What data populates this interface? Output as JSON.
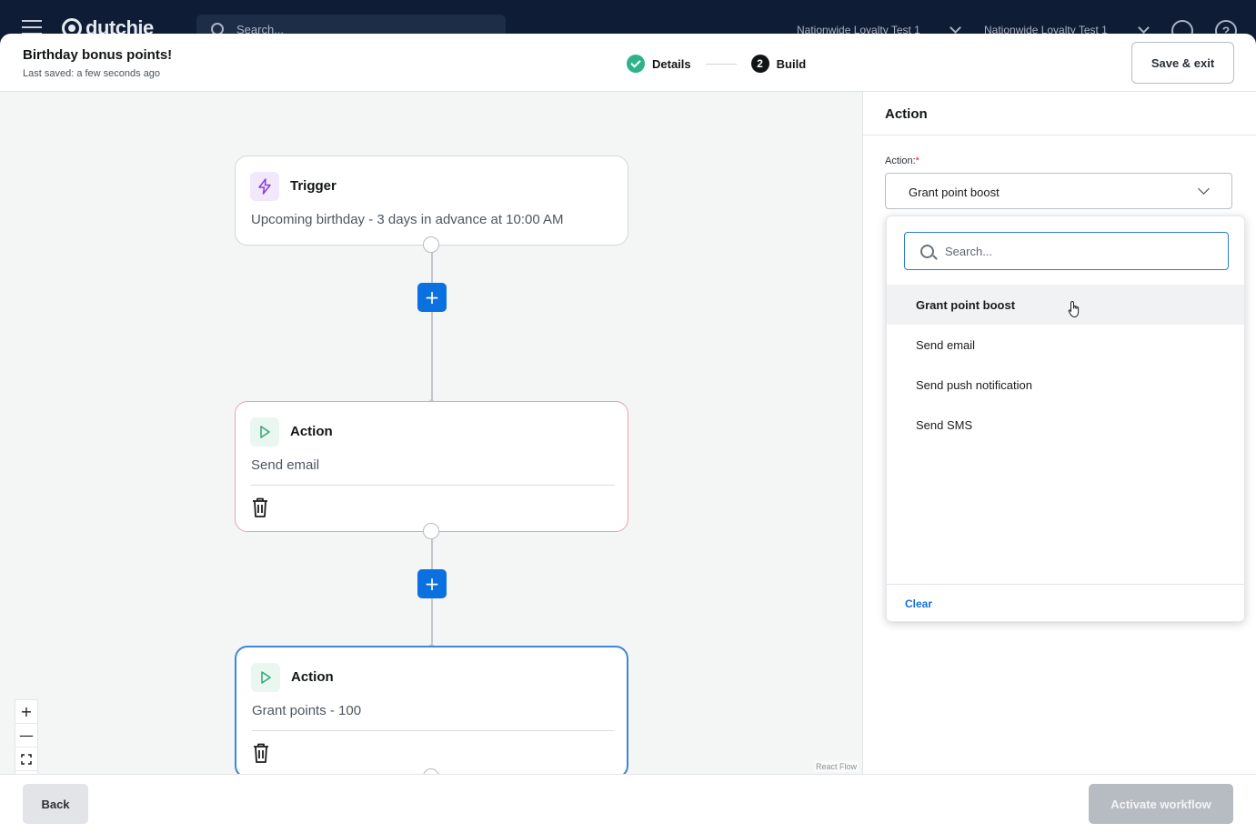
{
  "topbar": {
    "logo": "dutchie",
    "search_placeholder": "Search...",
    "location_1": "Nationwide Loyalty Test 1",
    "location_2": "Nationwide Loyalty Test 1",
    "account_icon": "user-circle-icon",
    "help_label": "?"
  },
  "header": {
    "title": "Birthday bonus points!",
    "last_saved": "Last saved: a few seconds ago",
    "steps": [
      {
        "label": "Details",
        "status": "done"
      },
      {
        "number": "2",
        "label": "Build",
        "status": "current"
      }
    ],
    "save_exit_label": "Save & exit"
  },
  "canvas": {
    "nodes": [
      {
        "type": "trigger",
        "title": "Trigger",
        "description": "Upcoming birthday - 3 days in advance at 10:00 AM",
        "icon": "lightning-icon"
      },
      {
        "type": "action",
        "title": "Action",
        "description": "Send email",
        "icon": "play-icon",
        "state": "error"
      },
      {
        "type": "action",
        "title": "Action",
        "description": "Grant points - 100",
        "icon": "play-icon",
        "state": "selected"
      }
    ],
    "add_label": "+",
    "zoom_controls": [
      "+",
      "—",
      "fit-view-icon",
      "lock-icon"
    ],
    "attribution": "React Flow"
  },
  "panel": {
    "title": "Action",
    "field_label": "Action:",
    "required_mark": "*",
    "selected_value": "Grant point boost",
    "search_placeholder": "Search...",
    "options": [
      "Grant point boost",
      "Send email",
      "Send push notification",
      "Send SMS"
    ],
    "clear_label": "Clear"
  },
  "footer": {
    "back_label": "Back",
    "activate_label": "Activate workflow"
  },
  "colors": {
    "primary": "#0b70e0",
    "success": "#2fb28a",
    "error_border": "#e6a4ad",
    "selected_border": "#3c88d7"
  }
}
